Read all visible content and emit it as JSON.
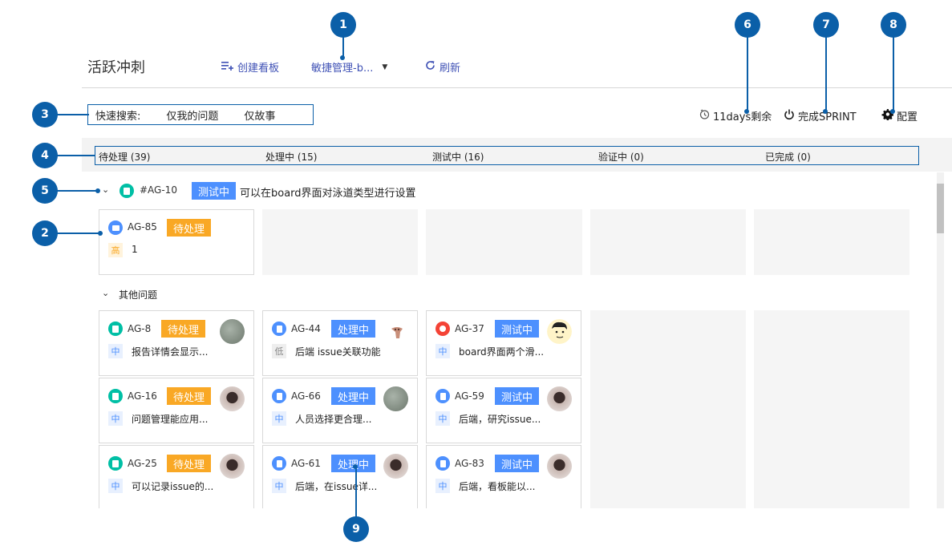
{
  "header": {
    "title": "活跃冲刺",
    "create_board": "创建看板",
    "board_select": "敏捷管理-b...",
    "refresh": "刷新"
  },
  "toolbar": {
    "quick_search_label": "快速搜索:",
    "quick_filters": [
      "仅我的问题",
      "仅故事"
    ],
    "remaining": "11days剩余",
    "complete_sprint": "完成SPRINT",
    "config": "配置"
  },
  "columns": [
    {
      "name": "待处理",
      "count": "(39)"
    },
    {
      "name": "处理中",
      "count": "(15)"
    },
    {
      "name": "测试中",
      "count": "(16)"
    },
    {
      "name": "验证中",
      "count": "(0)"
    },
    {
      "name": "已完成",
      "count": "(0)"
    }
  ],
  "swimlanes": [
    {
      "key": "#AG-10",
      "status": "测试中",
      "summary": "可以在board界面对泳道类型进行设置",
      "cards": [
        {
          "key": "AG-85",
          "status": "待处理",
          "priority": "高",
          "summary": "1",
          "type": "task"
        }
      ]
    },
    {
      "title": "其他问题",
      "cards": [
        {
          "key": "AG-8",
          "status": "待处理",
          "priority": "中",
          "summary": "报告详情会显示...",
          "type": "story"
        },
        {
          "key": "AG-16",
          "status": "待处理",
          "priority": "中",
          "summary": "问题管理能应用...",
          "type": "story"
        },
        {
          "key": "AG-25",
          "status": "待处理",
          "priority": "中",
          "summary": "可以记录issue的...",
          "type": "story"
        },
        {
          "key": "AG-44",
          "status": "处理中",
          "priority": "低",
          "summary": "后端 issue关联功能",
          "type": "task"
        },
        {
          "key": "AG-66",
          "status": "处理中",
          "priority": "中",
          "summary": "人员选择更合理...",
          "type": "task"
        },
        {
          "key": "AG-61",
          "status": "处理中",
          "priority": "中",
          "summary": "后端，在issue详...",
          "type": "task"
        },
        {
          "key": "AG-37",
          "status": "测试中",
          "priority": "中",
          "summary": "board界面两个滑...",
          "type": "bug"
        },
        {
          "key": "AG-59",
          "status": "测试中",
          "priority": "中",
          "summary": "后端，研究issue...",
          "type": "task"
        },
        {
          "key": "AG-83",
          "status": "测试中",
          "priority": "中",
          "summary": "后端，看板能以...",
          "type": "task"
        }
      ]
    }
  ],
  "callouts": [
    "1",
    "2",
    "3",
    "4",
    "5",
    "6",
    "7",
    "8",
    "9"
  ],
  "colors": {
    "accent": "#3f51b5",
    "callout": "#0b5fa8",
    "todo": "#f9a825",
    "doing": "#4d90fe",
    "story": "#00bfa5",
    "task": "#4d90fe",
    "bug": "#f44336"
  }
}
